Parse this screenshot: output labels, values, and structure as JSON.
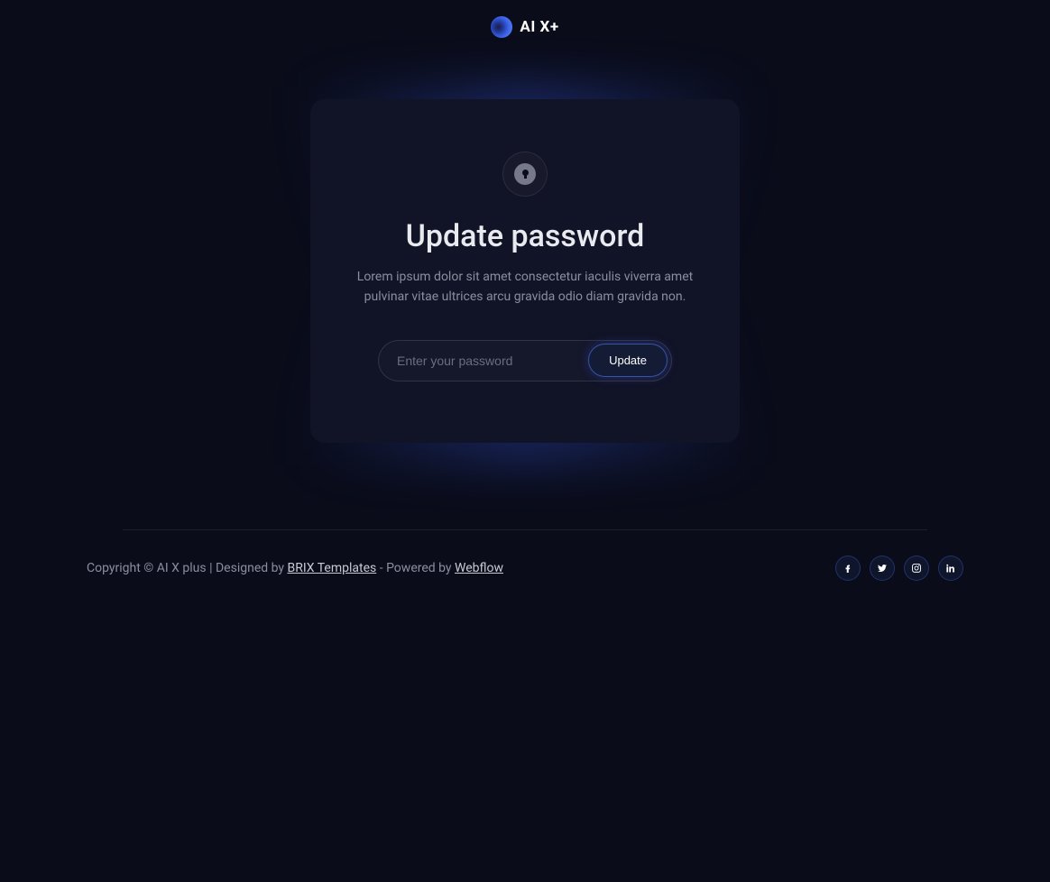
{
  "header": {
    "logo_text": "AI X+"
  },
  "card": {
    "title": "Update password",
    "description": "Lorem ipsum dolor sit amet consectetur iaculis viverra amet pulvinar vitae ultrices arcu gravida odio diam gravida non.",
    "password_placeholder": "Enter your password",
    "update_button_label": "Update"
  },
  "footer": {
    "copyright_prefix": "Copyright © AI X plus | Designed by ",
    "designer_link": "BRIX Templates",
    "powered_by_prefix": " - Powered by ",
    "powered_by_link": "Webflow"
  },
  "social": {
    "facebook": "facebook",
    "twitter": "twitter",
    "instagram": "instagram",
    "linkedin": "linkedin"
  }
}
